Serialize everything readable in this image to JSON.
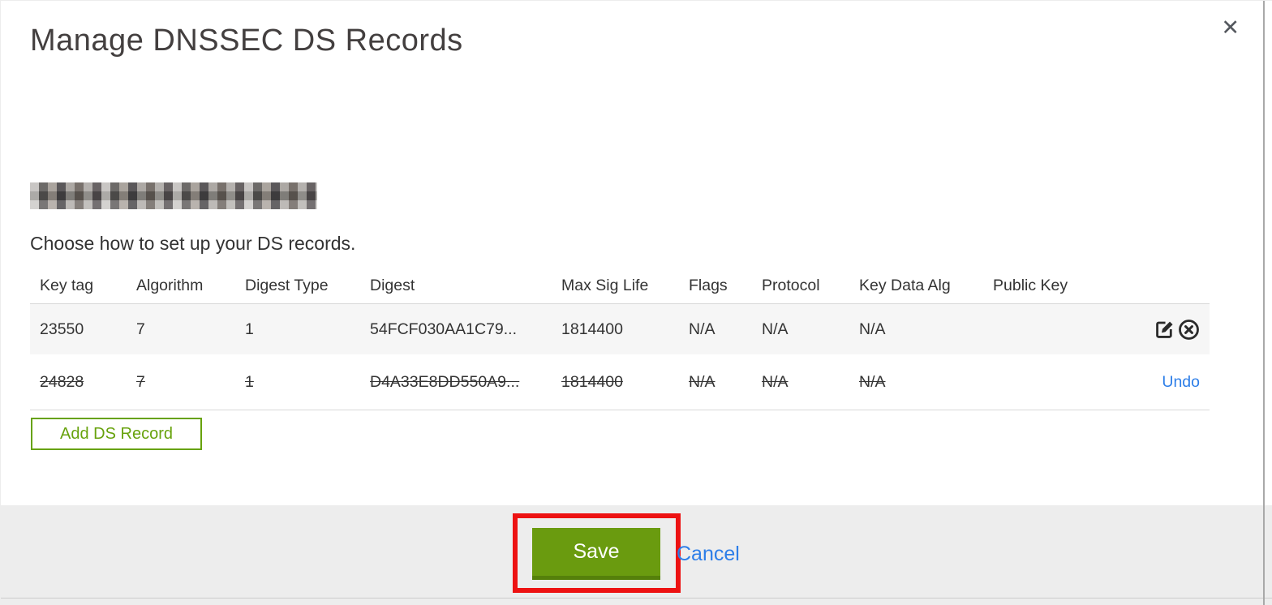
{
  "modal": {
    "title": "Manage DNSSEC DS Records",
    "subtitle": "Choose how to set up your DS records.",
    "domain_redacted": true
  },
  "icons": {
    "close": "✕",
    "edit": "edit-square-pencil",
    "delete": "circle-x"
  },
  "table": {
    "columns": [
      "Key tag",
      "Algorithm",
      "Digest Type",
      "Digest",
      "Max Sig Life",
      "Flags",
      "Protocol",
      "Key Data Alg",
      "Public Key"
    ],
    "rows": [
      {
        "key_tag": "23550",
        "algorithm": "7",
        "digest_type": "1",
        "digest": "54FCF030AA1C79...",
        "max_sig_life": "1814400",
        "flags": "N/A",
        "protocol": "N/A",
        "key_data_alg": "N/A",
        "public_key": "",
        "deleted": false,
        "actions": [
          "edit",
          "delete"
        ]
      },
      {
        "key_tag": "24828",
        "algorithm": "7",
        "digest_type": "1",
        "digest": "D4A33E8DD550A9...",
        "max_sig_life": "1814400",
        "flags": "N/A",
        "protocol": "N/A",
        "key_data_alg": "N/A",
        "public_key": "",
        "deleted": true,
        "actions": [
          "undo"
        ],
        "undo_label": "Undo"
      }
    ]
  },
  "buttons": {
    "add_ds_record": "Add DS Record",
    "save": "Save",
    "cancel": "Cancel"
  },
  "annotation": {
    "highlight_target": "save-button",
    "color": "#ed1212"
  },
  "colors": {
    "save_green": "#6a9b0f",
    "save_green_dark": "#55800a",
    "outline_green": "#67a20c",
    "link_blue": "#2d7ee8",
    "footer_gray": "#ededed",
    "row_stripe_gray": "#f6f6f6"
  }
}
